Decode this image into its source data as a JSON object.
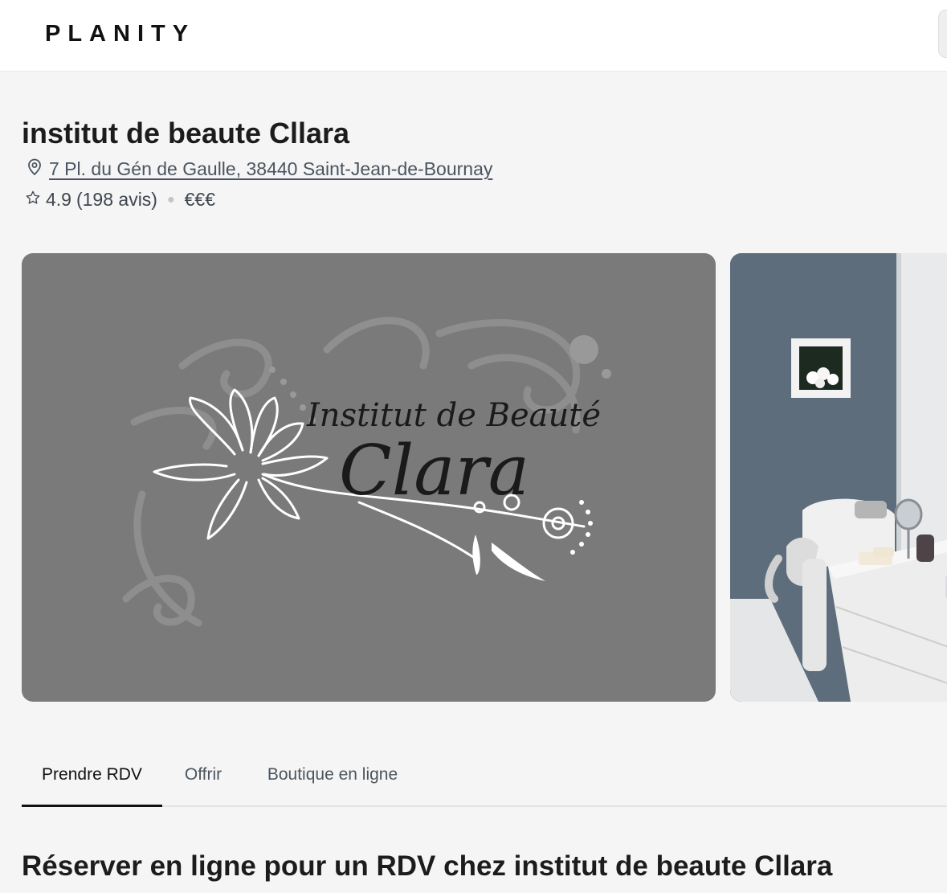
{
  "header": {
    "logo_text": "PLANITY"
  },
  "salon": {
    "name": "institut de beaute Cllara",
    "address": "7 Pl. du Gén de Gaulle, 38440 Saint-Jean-de-Bournay",
    "rating": "4.9",
    "reviews": "(198 avis)",
    "price": "€€€"
  },
  "gallery": {
    "logo_line1": "Institut de Beauté",
    "logo_line2": "Clara"
  },
  "tabs": [
    {
      "label": "Prendre RDV",
      "active": true
    },
    {
      "label": "Offrir",
      "active": false
    },
    {
      "label": "Boutique en ligne",
      "active": false
    }
  ],
  "booking": {
    "title": "Réserver en ligne pour un RDV chez institut de beaute Cllara"
  },
  "icons": {
    "location": "location-pin-icon",
    "rating": "star-icon"
  },
  "colors": {
    "background": "#f5f5f5",
    "topbar": "#ffffff",
    "text_primary": "#1c1c1c",
    "text_secondary": "#4a5460",
    "gallery_logo_bg": "#7b7a7b",
    "wall_blue": "#5d6c7b"
  }
}
